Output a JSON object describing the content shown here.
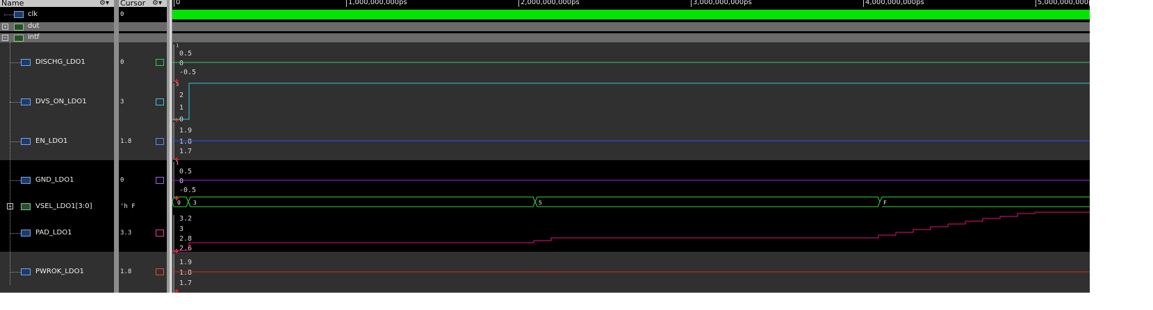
{
  "header": {
    "name_label": "Name",
    "cursor_label": "Cursor",
    "ruler_ticks": [
      "0",
      "1,000,000,000ps",
      "2,000,000,000ps",
      "3,000,000,000ps",
      "4,000,000,000ps",
      "5,000,000,000ps"
    ]
  },
  "signals": [
    {
      "name": "clk",
      "value": "0",
      "kind": "clock",
      "color": "#00e600"
    },
    {
      "name": "dut",
      "value": "",
      "kind": "group"
    },
    {
      "name": "intf",
      "value": "",
      "kind": "group"
    },
    {
      "name": "DISCHG_LDO1",
      "value": "0",
      "kind": "analog",
      "color": "#33cc66",
      "ticks": [
        "0.5",
        "0",
        "-0.5"
      ],
      "top_tick": "1"
    },
    {
      "name": "DVS_ON_LDO1",
      "value": "3",
      "kind": "analog",
      "color": "#3cc8d8",
      "ticks": [
        "2",
        "1",
        "0"
      ],
      "top_tick": "3"
    },
    {
      "name": "EN_LDO1",
      "value": "1.8",
      "kind": "analog",
      "color": "#2255ff",
      "ticks": [
        "1.9",
        "1.8",
        "1.7"
      ],
      "top_tick": ""
    },
    {
      "name": "GND_LDO1",
      "value": "0",
      "kind": "analog",
      "color": "#aa22ee",
      "ticks": [
        "0.5",
        "0",
        "-0.5"
      ],
      "top_tick": "1"
    },
    {
      "name": "VSEL_LDO1[3:0]",
      "value": "'h F",
      "kind": "bus",
      "color": "#33dd33",
      "segments": [
        "0",
        "3",
        "5",
        "F"
      ]
    },
    {
      "name": "PAD_LDO1",
      "value": "3.3",
      "kind": "analog",
      "color": "#ee1177",
      "ticks": [
        "3.2",
        "3",
        "2.8",
        "2.6"
      ],
      "top_tick": ""
    },
    {
      "name": "PWROK_LDO1",
      "value": "1.8",
      "kind": "analog",
      "color": "#dd2222",
      "ticks": [
        "1.9",
        "1.8",
        "1.7"
      ],
      "top_tick": ""
    }
  ]
}
